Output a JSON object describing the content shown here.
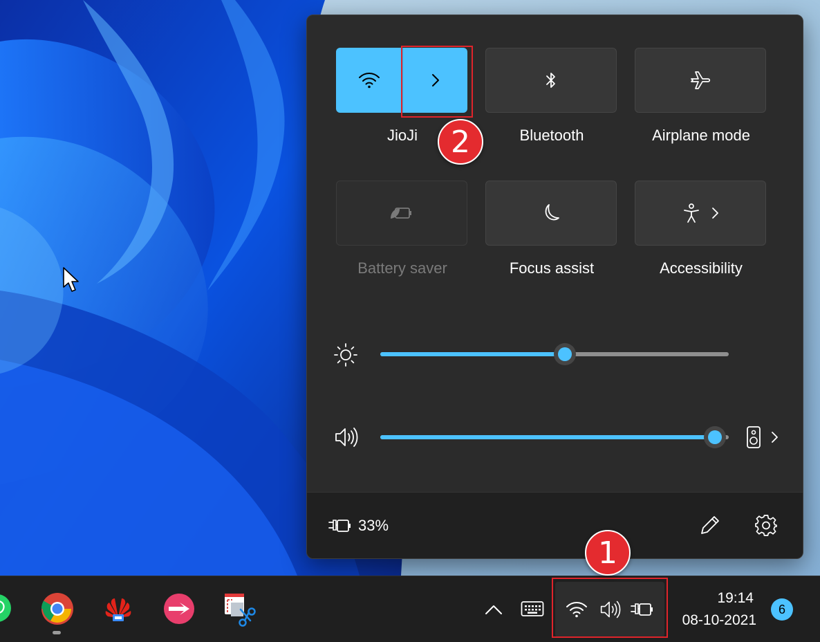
{
  "quick_settings": {
    "tiles": [
      {
        "id": "wifi",
        "label": "JioJi",
        "state": "on",
        "icon": "wifi-icon",
        "has_expand_arrow": true
      },
      {
        "id": "bluetooth",
        "label": "Bluetooth",
        "state": "off",
        "icon": "bluetooth-icon"
      },
      {
        "id": "airplane",
        "label": "Airplane mode",
        "state": "off",
        "icon": "airplane-icon"
      },
      {
        "id": "battery-saver",
        "label": "Battery saver",
        "state": "disabled",
        "icon": "battery-saver-icon"
      },
      {
        "id": "focus-assist",
        "label": "Focus assist",
        "state": "off",
        "icon": "moon-icon"
      },
      {
        "id": "accessibility",
        "label": "Accessibility",
        "state": "off",
        "icon": "accessibility-icon",
        "has_expand_arrow": true
      }
    ],
    "brightness": {
      "icon": "brightness-icon",
      "value_percent": 53
    },
    "volume": {
      "icon": "speaker-icon",
      "value_percent": 96,
      "output_icon": "speaker-device-icon"
    },
    "footer": {
      "battery_percent": "33%",
      "battery_icon": "battery-charging-icon",
      "edit_icon": "pencil-icon",
      "settings_icon": "gear-icon"
    }
  },
  "annotations": {
    "step1": "1",
    "step2": "2",
    "highlight_color": "#e0242b"
  },
  "taskbar": {
    "apps": [
      "whatsapp-icon",
      "chrome-icon",
      "huawei-icon",
      "app-icon",
      "snipping-tool-icon"
    ],
    "tray": [
      "chevron-up-icon",
      "keyboard-icon",
      "wifi-icon",
      "speaker-icon",
      "battery-charging-icon"
    ],
    "time": "19:14",
    "date": "08-10-2021",
    "notification_count": "6"
  },
  "colors": {
    "accent": "#4cc2ff",
    "panel": "#2b2b2b",
    "taskbar": "#1f1f1f"
  }
}
